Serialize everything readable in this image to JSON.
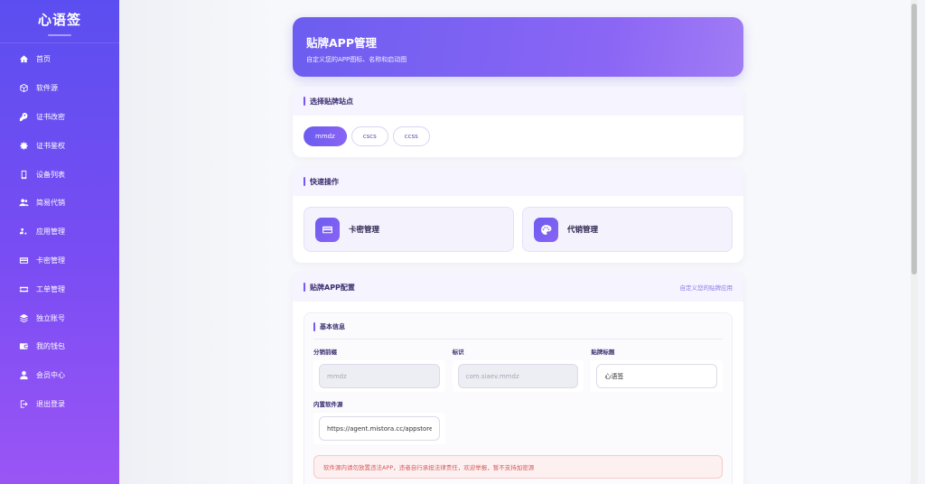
{
  "brand": {
    "title": "心语签"
  },
  "nav": [
    {
      "label": "首页",
      "icon": "home-icon"
    },
    {
      "label": "软件源",
      "icon": "box-icon"
    },
    {
      "label": "证书改密",
      "icon": "key-icon"
    },
    {
      "label": "证书鉴权",
      "icon": "gear-icon"
    },
    {
      "label": "设备列表",
      "icon": "phone-icon"
    },
    {
      "label": "简易代销",
      "icon": "users-icon"
    },
    {
      "label": "应用管理",
      "icon": "apps-icon"
    },
    {
      "label": "卡密管理",
      "icon": "card-icon"
    },
    {
      "label": "工单管理",
      "icon": "ticket-icon"
    },
    {
      "label": "独立账号",
      "icon": "layers-icon"
    },
    {
      "label": "我的钱包",
      "icon": "wallet-icon"
    },
    {
      "label": "会员中心",
      "icon": "user-icon"
    },
    {
      "label": "退出登录",
      "icon": "logout-icon"
    }
  ],
  "hero": {
    "title": "贴牌APP管理",
    "subtitle": "自定义您的APP图标、名称和启动图"
  },
  "site_section": {
    "title": "选择贴牌站点",
    "sites": [
      "mmdz",
      "cscs",
      "ccss"
    ],
    "active": "mmdz"
  },
  "quick_section": {
    "title": "快速操作",
    "card_label": "卡密管理",
    "resale_label": "代销管理"
  },
  "config_section": {
    "title": "贴牌APP配置",
    "link": "自定义您的贴牌应用",
    "basic_title": "基本信息",
    "prefix_label": "分销前缀",
    "prefix_value": "mmdz",
    "id_label": "标识",
    "id_value": "com.siaev.mmdz",
    "brand_title_label": "贴牌标题",
    "brand_title_value": "心语签",
    "source_label": "内置软件源",
    "source_value": "https://agent.mistora.cc/appstore",
    "warning": "软件源内请勿放置违法APP，违者自行承担法律责任，欢迎举报，暂不支持加密源"
  },
  "colors": {
    "accent": "#6c5df0",
    "accent2": "#8b66f5",
    "warning": "#d65a5a"
  }
}
